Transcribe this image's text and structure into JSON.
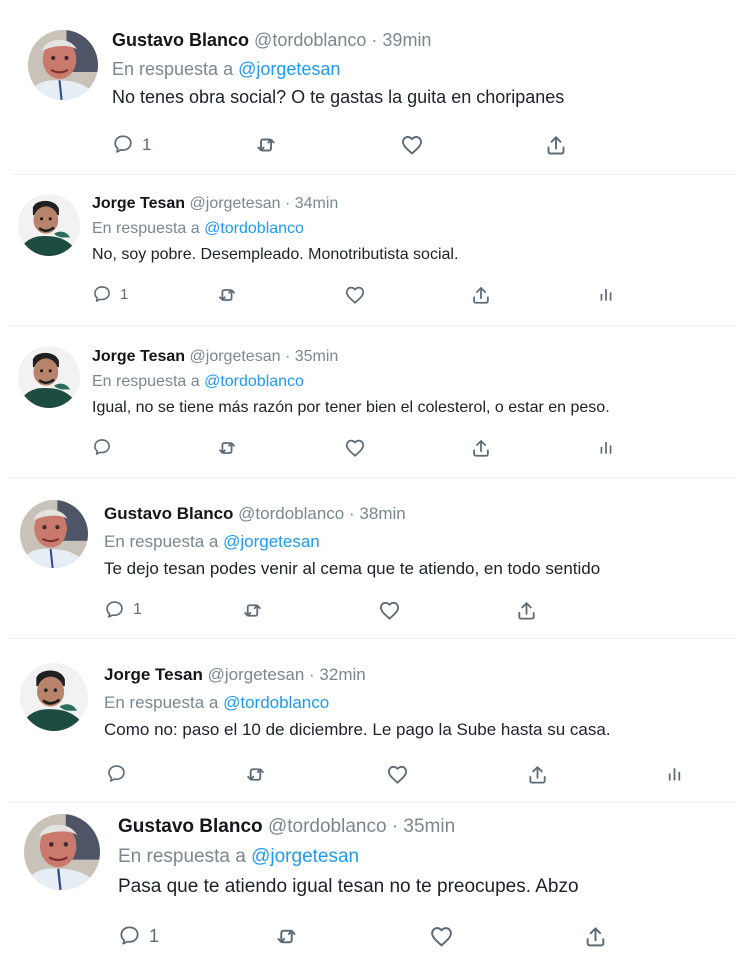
{
  "tweets": [
    {
      "name": "Gustavo Blanco",
      "handle": "@tordoblanco",
      "dot": "·",
      "time": "39min",
      "reply_prefix": "En respuesta a",
      "reply_to": "@jorgetesan",
      "text": "No tenes obra social? O te gastas la guita en choripanes",
      "reply_count": "1",
      "avatar_icon": "portrait-avatar-gustavo"
    },
    {
      "name": "Jorge Tesan",
      "handle": "@jorgetesan",
      "dot": "·",
      "time": "34min",
      "reply_prefix": "En respuesta a",
      "reply_to": "@tordoblanco",
      "text": "No, soy pobre. Desempleado. Monotributista social.",
      "reply_count": "1",
      "avatar_icon": "portrait-avatar-jorge"
    },
    {
      "name": "Jorge Tesan",
      "handle": "@jorgetesan",
      "dot": "·",
      "time": "35min",
      "reply_prefix": "En respuesta a",
      "reply_to": "@tordoblanco",
      "text": "Igual, no se tiene más razón por tener bien el colesterol, o estar en peso.",
      "reply_count": "",
      "avatar_icon": "portrait-avatar-jorge"
    },
    {
      "name": "Gustavo Blanco",
      "handle": "@tordoblanco",
      "dot": "·",
      "time": "38min",
      "reply_prefix": "En respuesta a",
      "reply_to": "@jorgetesan",
      "text": "Te dejo tesan podes venir al cema que te atiendo, en todo sentido",
      "reply_count": "1",
      "avatar_icon": "portrait-avatar-gustavo"
    },
    {
      "name": "Jorge Tesan",
      "handle": "@jorgetesan",
      "dot": "·",
      "time": "32min",
      "reply_prefix": "En respuesta a",
      "reply_to": "@tordoblanco",
      "text": "Como no: paso el 10 de diciembre. Le pago la Sube hasta su casa.",
      "reply_count": "",
      "avatar_icon": "portrait-avatar-jorge"
    },
    {
      "name": "Gustavo Blanco",
      "handle": "@tordoblanco",
      "dot": "·",
      "time": "35min",
      "reply_prefix": "En respuesta a",
      "reply_to": "@jorgetesan",
      "text": "Pasa que te atiendo igual tesan no te preocupes. Abzo",
      "reply_count": "1",
      "avatar_icon": "portrait-avatar-gustavo"
    }
  ],
  "icons": {
    "reply": "reply-icon",
    "retweet": "retweet-icon",
    "like": "like-icon",
    "share": "share-icon",
    "analytics": "analytics-icon"
  },
  "colors": {
    "mention": "#1d9bf0",
    "muted": "#7a8790",
    "icon": "#5c6b75"
  }
}
